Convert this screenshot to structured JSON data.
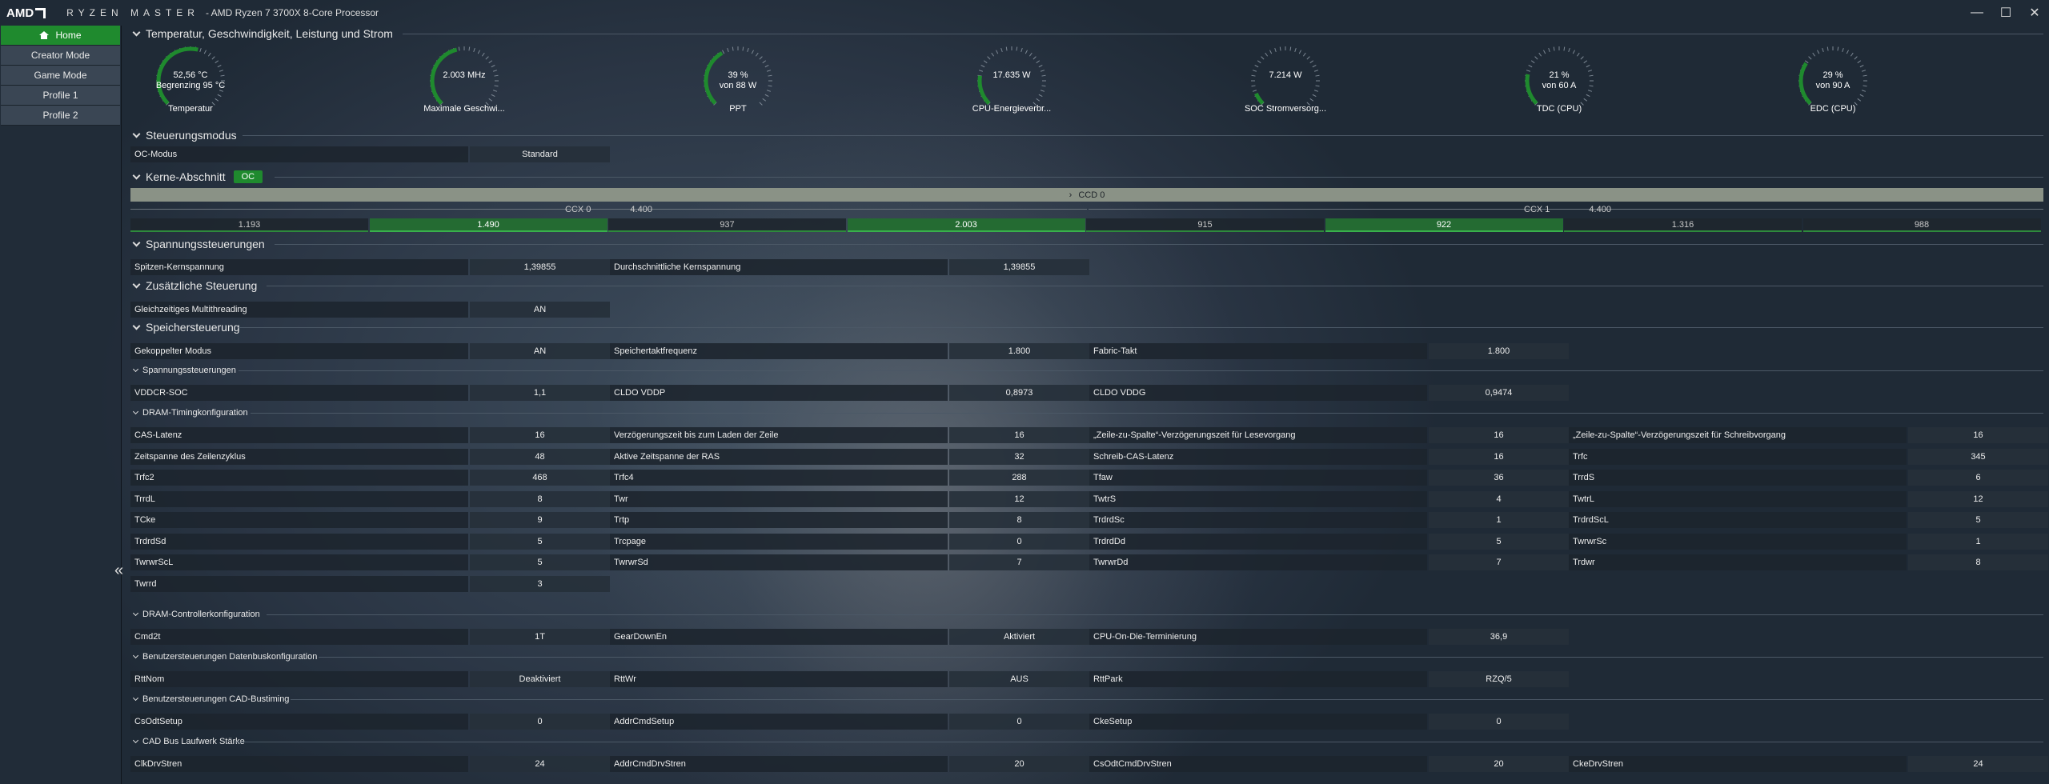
{
  "app": {
    "logo": "AMD",
    "brand": "RYZEN MASTER",
    "cpu": "- AMD Ryzen 7 3700X 8-Core Processor"
  },
  "window": {
    "minimize": "—",
    "maximize": "☐",
    "close": "✕"
  },
  "sidebar": {
    "items": [
      {
        "label": "Home",
        "active": true
      },
      {
        "label": "Creator Mode"
      },
      {
        "label": "Game Mode"
      },
      {
        "label": "Profile 1"
      },
      {
        "label": "Profile 2"
      }
    ],
    "collapse": "«"
  },
  "accent": "#1f8a2e",
  "sections": {
    "temp": "Temperatur, Geschwindigkeit, Leistung und Strom",
    "mode": "Steuerungsmodus",
    "cores": "Kerne-Abschnitt",
    "cores_badge": "OC",
    "voltage": "Spannungssteuerungen",
    "extra": "Zusätzliche Steuerung",
    "memory": "Speichersteuerung",
    "mem_voltage": "Spannungssteuerungen",
    "dram_timing": "DRAM-Timingkonfiguration",
    "dram_ctrl": "DRAM-Controllerkonfiguration",
    "databus": "Benutzersteuerungen Datenbuskonfiguration",
    "cad": "Benutzersteuerungen CAD-Bustiming",
    "cadbus": "CAD Bus Laufwerk Stärke"
  },
  "gauges": [
    {
      "line1": "52,56 °C",
      "line2": "Begrenzing 95 °C",
      "label": "Temperatur",
      "fill": 0.55
    },
    {
      "line1": "2.003  MHz",
      "line2": "",
      "label": "Maximale Geschwi...",
      "fill": 0.45
    },
    {
      "line1": "39 %",
      "line2": "von 88 W",
      "label": "PPT",
      "fill": 0.39
    },
    {
      "line1": "17.635 W",
      "line2": "",
      "label": "CPU-Energieverbr...",
      "fill": 0.2
    },
    {
      "line1": "7.214 W",
      "line2": "",
      "label": "SOC Stromversorg...",
      "fill": 0.08
    },
    {
      "line1": "21 %",
      "line2": "von 60 A",
      "label": "TDC (CPU)",
      "fill": 0.21
    },
    {
      "line1": "29 %",
      "line2": "von 90 A",
      "label": "EDC (CPU)",
      "fill": 0.29
    }
  ],
  "oc_mode": {
    "label": "OC-Modus",
    "value": "Standard"
  },
  "ccd": {
    "label": "CCD 0",
    "arrow": "›"
  },
  "ccx": [
    {
      "name": "CCX 0",
      "freq": "4.400"
    },
    {
      "name": "CCX 1",
      "freq": "4.400"
    }
  ],
  "cores": [
    {
      "v": "1.193",
      "hl": false
    },
    {
      "v": "1.490",
      "hl": true
    },
    {
      "v": "937",
      "hl": false
    },
    {
      "v": "2.003",
      "hl": true
    },
    {
      "v": "915",
      "hl": false
    },
    {
      "v": "922",
      "hl": true
    },
    {
      "v": "1.316",
      "hl": false
    },
    {
      "v": "988",
      "hl": false
    }
  ],
  "voltage": [
    {
      "label": "Spitzen-Kernspannung",
      "value": "1,39855"
    },
    {
      "label": "Durchschnittliche Kernspannung",
      "value": "1,39855"
    }
  ],
  "extra": [
    {
      "label": "Gleichzeitiges Multithreading",
      "value": "AN"
    }
  ],
  "memory": [
    {
      "label": "Gekoppelter Modus",
      "value": "AN"
    },
    {
      "label": "Speichertaktfrequenz",
      "value": "1.800"
    },
    {
      "label": "Fabric-Takt",
      "value": "1.800"
    }
  ],
  "mem_voltage": [
    {
      "label": "VDDCR-SOC",
      "value": "1,1"
    },
    {
      "label": "CLDO VDDP",
      "value": "0,8973"
    },
    {
      "label": "CLDO VDDG",
      "value": "0,9474"
    }
  ],
  "dram_timing": [
    [
      {
        "label": "CAS-Latenz",
        "value": "16"
      },
      {
        "label": "Verzögerungszeit bis zum Laden der Zeile",
        "value": "16"
      },
      {
        "label": "„Zeile-zu-Spalte“-Verzögerungszeit für Lesevorgang",
        "value": "16"
      },
      {
        "label": "„Zeile-zu-Spalte“-Verzögerungszeit für Schreibvorgang",
        "value": "16"
      }
    ],
    [
      {
        "label": "Zeitspanne des Zeilenzyklus",
        "value": "48"
      },
      {
        "label": "Aktive Zeitspanne der RAS",
        "value": "32"
      },
      {
        "label": "Schreib-CAS-Latenz",
        "value": "16"
      },
      {
        "label": "Trfc",
        "value": "345"
      }
    ],
    [
      {
        "label": "Trfc2",
        "value": "468"
      },
      {
        "label": "Trfc4",
        "value": "288"
      },
      {
        "label": "Tfaw",
        "value": "36"
      },
      {
        "label": "TrrdS",
        "value": "6"
      }
    ],
    [
      {
        "label": "TrrdL",
        "value": "8"
      },
      {
        "label": "Twr",
        "value": "12"
      },
      {
        "label": "TwtrS",
        "value": "4"
      },
      {
        "label": "TwtrL",
        "value": "12"
      }
    ],
    [
      {
        "label": "TCke",
        "value": "9"
      },
      {
        "label": "Trtp",
        "value": "8"
      },
      {
        "label": "TrdrdSc",
        "value": "1"
      },
      {
        "label": "TrdrdScL",
        "value": "5"
      }
    ],
    [
      {
        "label": "TrdrdSd",
        "value": "5"
      },
      {
        "label": "Trcpage",
        "value": "0"
      },
      {
        "label": "TrdrdDd",
        "value": "5"
      },
      {
        "label": "TwrwrSc",
        "value": "1"
      }
    ],
    [
      {
        "label": "TwrwrScL",
        "value": "5"
      },
      {
        "label": "TwrwrSd",
        "value": "7"
      },
      {
        "label": "TwrwrDd",
        "value": "7"
      },
      {
        "label": "Trdwr",
        "value": "8"
      }
    ],
    [
      {
        "label": "Twrrd",
        "value": "3"
      }
    ]
  ],
  "dram_ctrl": [
    {
      "label": "Cmd2t",
      "value": "1T"
    },
    {
      "label": "GearDownEn",
      "value": "Aktiviert"
    },
    {
      "label": "CPU-On-Die-Terminierung",
      "value": "36,9"
    }
  ],
  "databus": [
    {
      "label": "RttNom",
      "value": "Deaktiviert"
    },
    {
      "label": "RttWr",
      "value": "AUS"
    },
    {
      "label": "RttPark",
      "value": "RZQ/5"
    }
  ],
  "cad": [
    {
      "label": "CsOdtSetup",
      "value": "0"
    },
    {
      "label": "AddrCmdSetup",
      "value": "0"
    },
    {
      "label": "CkeSetup",
      "value": "0"
    }
  ],
  "cadbus": [
    {
      "label": "ClkDrvStren",
      "value": "24"
    },
    {
      "label": "AddrCmdDrvStren",
      "value": "20"
    },
    {
      "label": "CsOdtCmdDrvStren",
      "value": "20"
    },
    {
      "label": "CkeDrvStren",
      "value": "24"
    }
  ]
}
